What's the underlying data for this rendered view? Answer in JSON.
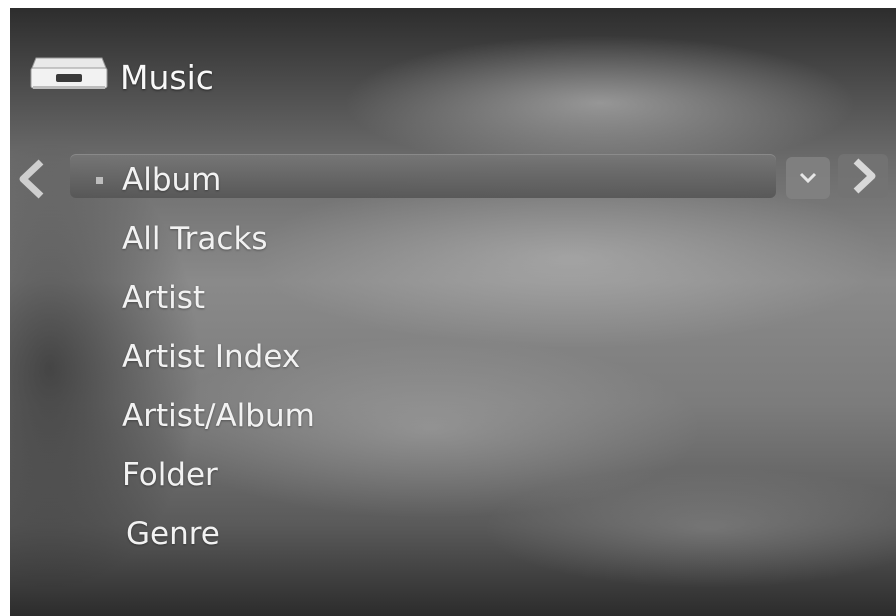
{
  "header": {
    "title": "Music",
    "icon": "drive-icon"
  },
  "menu": {
    "items": [
      {
        "label": "Album",
        "selected": true
      },
      {
        "label": "All Tracks",
        "selected": false
      },
      {
        "label": "Artist",
        "selected": false
      },
      {
        "label": "Artist Index",
        "selected": false
      },
      {
        "label": "Artist/Album",
        "selected": false
      },
      {
        "label": "Folder",
        "selected": false
      },
      {
        "label": "Genre",
        "selected": false
      }
    ]
  },
  "controls": {
    "left_icon": "chevron-left-icon",
    "dropdown_icon": "chevron-down-icon",
    "right_icon": "chevron-right-icon"
  },
  "colors": {
    "text": "#f2f2f2",
    "highlight": "#6e6e6e",
    "bullet": "#bdbdbd"
  }
}
